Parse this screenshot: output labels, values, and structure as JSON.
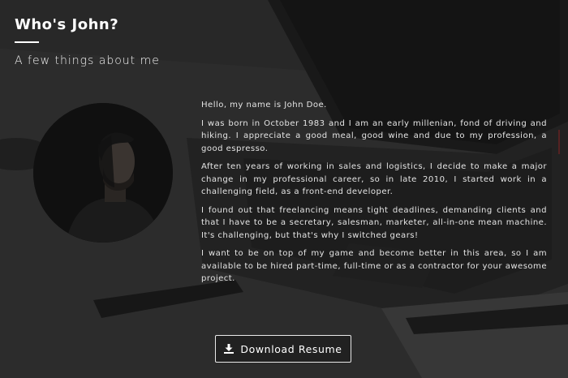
{
  "header": {
    "title": "Who's John?",
    "subtitle": "A few things about me"
  },
  "bio": {
    "paragraphs": [
      "Hello, my name is John Doe.",
      "I was born in October 1983 and I am an early millenian, fond of driving and hiking. I appreciate a good meal, good wine and due to my profession, a good espresso.",
      "After ten years of working in sales and logistics, I decide to make a major change in my professional career, so in late 2010, I started work in a challenging field, as a front-end developer.",
      "I found out that freelancing means tight deadlines, demanding clients and that I have to be a secretary, salesman, marketer, all-in-one mean machine. It's challenging, but that's why I switched gears!",
      "I want to be on top of my game and become better in this area, so I am available to be hired part-time, full-time or as a contractor for your awesome project."
    ]
  },
  "actions": {
    "download_label": "Download Resume",
    "download_icon": "download-icon"
  },
  "colors": {
    "text": "#ffffff",
    "button_border": "#e9e9e9",
    "background": "#2d2d2d"
  }
}
